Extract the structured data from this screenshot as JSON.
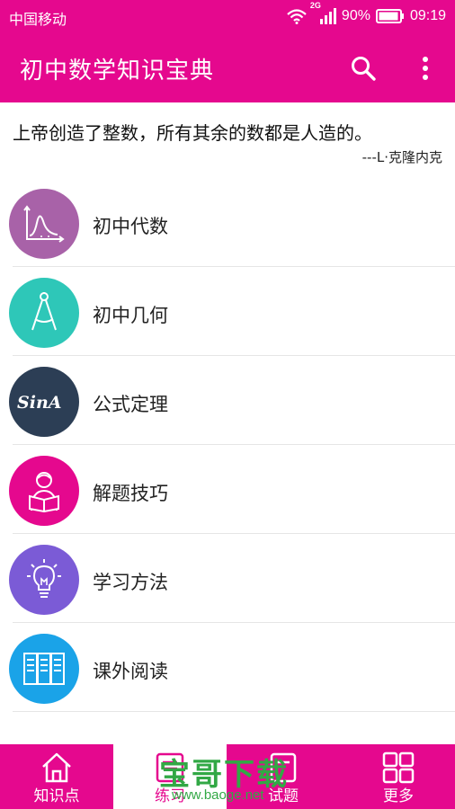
{
  "status_bar": {
    "carrier": "中国移动",
    "network": "2G",
    "battery": "90%",
    "time": "09:19"
  },
  "app_bar": {
    "title": "初中数学知识宝典",
    "search_icon": "search-icon",
    "menu_icon": "more-vert-icon"
  },
  "quote": {
    "text": "上帝创造了整数，所有其余的数都是人造的。",
    "author": "---L·克隆内克"
  },
  "categories": [
    {
      "label": "初中代数",
      "icon": "function-graph-icon",
      "color": "#a862a8"
    },
    {
      "label": "初中几何",
      "icon": "compass-icon",
      "color": "#2ec7b8"
    },
    {
      "label": "公式定理",
      "icon": "sina-icon",
      "color": "#2c3e55"
    },
    {
      "label": "解题技巧",
      "icon": "reader-icon",
      "color": "#e5088e"
    },
    {
      "label": "学习方法",
      "icon": "lightbulb-icon",
      "color": "#7b5bd6"
    },
    {
      "label": "课外阅读",
      "icon": "bookshelf-icon",
      "color": "#1aa3e8"
    }
  ],
  "bottom_nav": {
    "items": [
      {
        "label": "知识点",
        "icon": "home-icon"
      },
      {
        "label": "练习",
        "icon": "practice-icon"
      },
      {
        "label": "试题",
        "icon": "exam-icon"
      },
      {
        "label": "更多",
        "icon": "grid-icon"
      }
    ],
    "active_index": 1
  },
  "watermark": {
    "title": "宝哥下载",
    "url": "www.baoge.net"
  },
  "colors": {
    "primary": "#e5088e",
    "watermark": "#32a845"
  }
}
